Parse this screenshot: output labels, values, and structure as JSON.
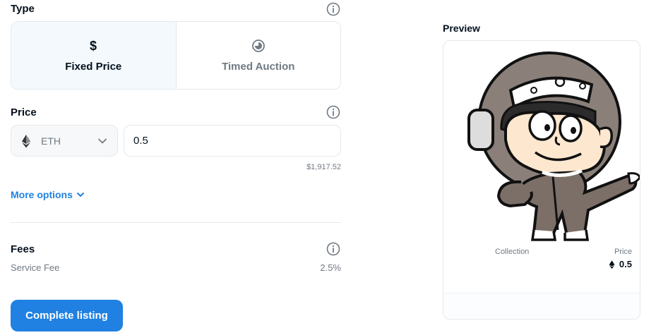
{
  "type_section": {
    "title": "Type",
    "options": [
      {
        "label": "Fixed Price",
        "icon": "dollar-icon",
        "selected": true
      },
      {
        "label": "Timed Auction",
        "icon": "timer-icon",
        "selected": false
      }
    ]
  },
  "price_section": {
    "title": "Price",
    "currency": "ETH",
    "amount": "0.5",
    "usd_value": "$1,917.52"
  },
  "more_options_label": "More options",
  "fees_section": {
    "title": "Fees",
    "service_fee_label": "Service Fee",
    "service_fee_value": "2.5%"
  },
  "complete_button_label": "Complete listing",
  "preview": {
    "title": "Preview",
    "collection_label": "Collection",
    "price_label": "Price",
    "price_value": "0.5"
  },
  "colors": {
    "accent": "#2081e2",
    "selected_bg": "#f3f9fd",
    "border": "#e5e8eb",
    "muted_text": "#707a83"
  }
}
